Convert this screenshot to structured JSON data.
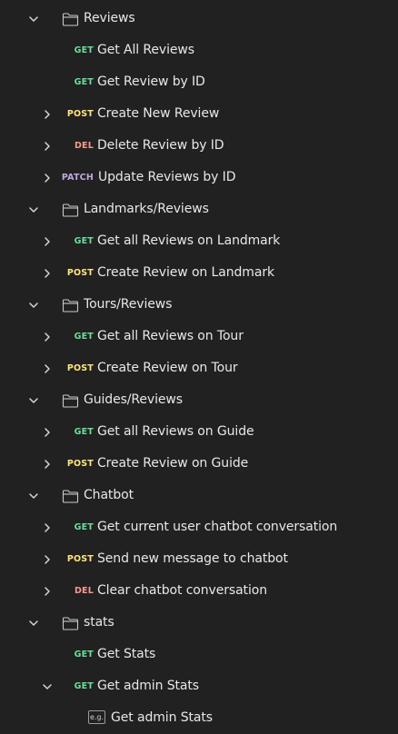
{
  "colors": {
    "GET": "#6bdd9a",
    "POST": "#ffe47e",
    "DEL": "#f79a8e",
    "PATCH": "#c0a8e1"
  },
  "rows": [
    {
      "kind": "folder",
      "depth": 0,
      "chevron": "down",
      "label": "Reviews"
    },
    {
      "kind": "request",
      "depth": 1,
      "chevron": "none",
      "method": "GET",
      "label": "Get All Reviews"
    },
    {
      "kind": "request",
      "depth": 1,
      "chevron": "none",
      "method": "GET",
      "label": "Get Review by ID"
    },
    {
      "kind": "request",
      "depth": 1,
      "chevron": "right",
      "method": "POST",
      "label": "Create New Review"
    },
    {
      "kind": "request",
      "depth": 1,
      "chevron": "right",
      "method": "DEL",
      "label": "Delete Review by ID"
    },
    {
      "kind": "request",
      "depth": 1,
      "chevron": "right",
      "method": "PATCH",
      "label": "Update Reviews by ID"
    },
    {
      "kind": "folder",
      "depth": 0,
      "chevron": "down",
      "label": "Landmarks/Reviews"
    },
    {
      "kind": "request",
      "depth": 1,
      "chevron": "right",
      "method": "GET",
      "label": "Get all Reviews on Landmark"
    },
    {
      "kind": "request",
      "depth": 1,
      "chevron": "right",
      "method": "POST",
      "label": "Create Review on Landmark"
    },
    {
      "kind": "folder",
      "depth": 0,
      "chevron": "down",
      "label": "Tours/Reviews"
    },
    {
      "kind": "request",
      "depth": 1,
      "chevron": "right",
      "method": "GET",
      "label": "Get all Reviews on Tour"
    },
    {
      "kind": "request",
      "depth": 1,
      "chevron": "right",
      "method": "POST",
      "label": "Create Review on Tour"
    },
    {
      "kind": "folder",
      "depth": 0,
      "chevron": "down",
      "label": "Guides/Reviews"
    },
    {
      "kind": "request",
      "depth": 1,
      "chevron": "right",
      "method": "GET",
      "label": "Get all Reviews on Guide"
    },
    {
      "kind": "request",
      "depth": 1,
      "chevron": "right",
      "method": "POST",
      "label": "Create Review on Guide"
    },
    {
      "kind": "folder",
      "depth": 0,
      "chevron": "down",
      "label": "Chatbot"
    },
    {
      "kind": "request",
      "depth": 1,
      "chevron": "right",
      "method": "GET",
      "label": "Get current user chatbot conversation"
    },
    {
      "kind": "request",
      "depth": 1,
      "chevron": "right",
      "method": "POST",
      "label": "Send new message to chatbot"
    },
    {
      "kind": "request",
      "depth": 1,
      "chevron": "right",
      "method": "DEL",
      "label": "Clear chatbot conversation"
    },
    {
      "kind": "folder",
      "depth": 0,
      "chevron": "down",
      "label": "stats"
    },
    {
      "kind": "request",
      "depth": 1,
      "chevron": "none",
      "method": "GET",
      "label": "Get Stats"
    },
    {
      "kind": "request",
      "depth": 1,
      "chevron": "down",
      "method": "GET",
      "label": "Get admin Stats"
    },
    {
      "kind": "example",
      "depth": 2,
      "chevron": "none",
      "badge": "e.g.",
      "label": "Get admin Stats"
    }
  ]
}
